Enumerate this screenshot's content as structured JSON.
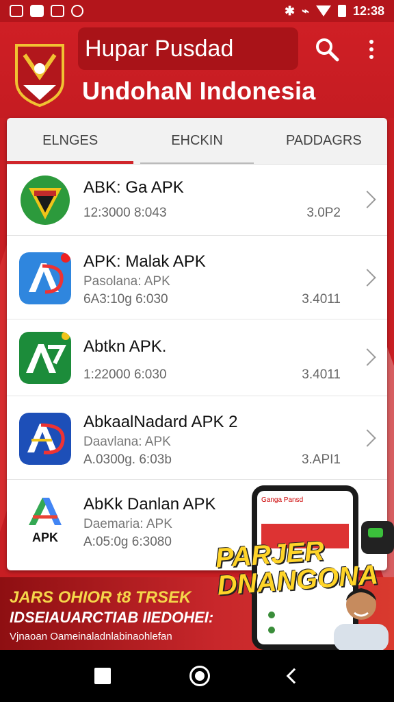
{
  "status_bar": {
    "left_icons": [
      "notification-icon",
      "notification-icon",
      "notification-icon",
      "notification-icon"
    ],
    "time": "12:38"
  },
  "header": {
    "search_text": "Hupar Pusdad",
    "title": "UndohaN Indonesia"
  },
  "tabs": [
    {
      "label": "ELNGES"
    },
    {
      "label": "EHCKIN"
    },
    {
      "label": "PADDAGRS"
    }
  ],
  "apps": [
    {
      "title": "ABK: Ga APK",
      "subtitle": "",
      "meta": "12:3000 8:043",
      "size": "3.0P2",
      "icon": "ga-apk-icon"
    },
    {
      "title": "APK: Malak APK",
      "subtitle": "Pasolana: APK",
      "meta": "6A3:10g 6:030",
      "size": "3.4011",
      "icon": "malak-apk-icon"
    },
    {
      "title": "Abtkn APK.",
      "subtitle": "",
      "meta": "1:22000 6:030",
      "size": "3.4011",
      "icon": "abtkn-apk-icon"
    },
    {
      "title": "AbkaalNadard APK 2",
      "subtitle": "Daavlana: APK",
      "meta": "A.0300g. 6:03b",
      "size": "3.API1",
      "icon": "abkaal-apk-icon"
    },
    {
      "title": "AbKk Danlan APK",
      "subtitle": "Daemaria: APK",
      "meta": "A:05:0g 6:3080",
      "size": "",
      "icon": "apk-icon",
      "icon_label": "APK"
    }
  ],
  "promo": {
    "line1": "JARS OHIOR t8 TRSEK",
    "line2": "IDSEIAUARCTIAB IIEDOHEI:",
    "line3": "Vjnaoan Oameinaladnlabinaohlefan",
    "big_text": "PARJER DNANGONA",
    "phone_top": "Ganga Pansd"
  },
  "colors": {
    "brand_red": "#c81e23",
    "accent_yellow": "#ffd428"
  }
}
